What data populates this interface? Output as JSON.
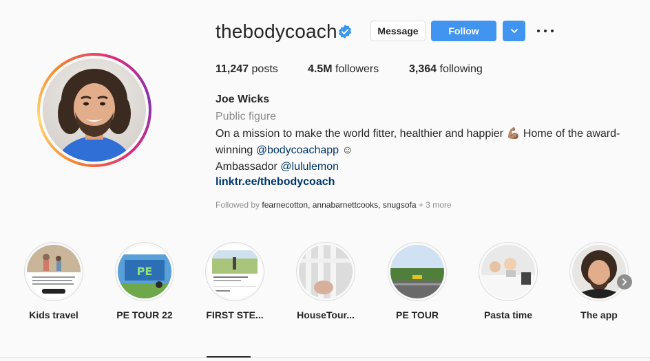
{
  "profile": {
    "username": "thebodycoach",
    "message_label": "Message",
    "follow_label": "Follow",
    "dropdown_icon": "chevron-down-icon",
    "more_icon": "more-options-icon",
    "verified_color": "#3897f0",
    "follow_color": "#4194ef"
  },
  "stats": {
    "posts_count": "11,247",
    "posts_label": "posts",
    "followers_count": "4.5M",
    "followers_label": "followers",
    "following_count": "3,364",
    "following_label": "following"
  },
  "bio": {
    "name": "Joe Wicks",
    "category": "Public figure",
    "line1_a": "On a mission to make the world fitter, healthier and happier ",
    "line1_emoji": "💪🏽",
    "line1_b": " Home of the award-winning ",
    "mention1": "@bodycoachapp",
    "line1_emoji2": " ☺",
    "line2_a": "Ambassador ",
    "mention2": "@lululemon",
    "url": "linktr.ee/thebodycoach"
  },
  "followed_by": {
    "prefix": "Followed by ",
    "users": "fearnecotton, annabarnettcooks, snugsofa",
    "suffix": " + 3 more"
  },
  "highlights": [
    {
      "label": "Kids travel"
    },
    {
      "label": "PE TOUR 22"
    },
    {
      "label": "FIRST STE..."
    },
    {
      "label": "HouseTour..."
    },
    {
      "label": "PE TOUR"
    },
    {
      "label": "Pasta time"
    },
    {
      "label": "The app"
    }
  ],
  "highlights_next_icon": "chevron-right-icon"
}
